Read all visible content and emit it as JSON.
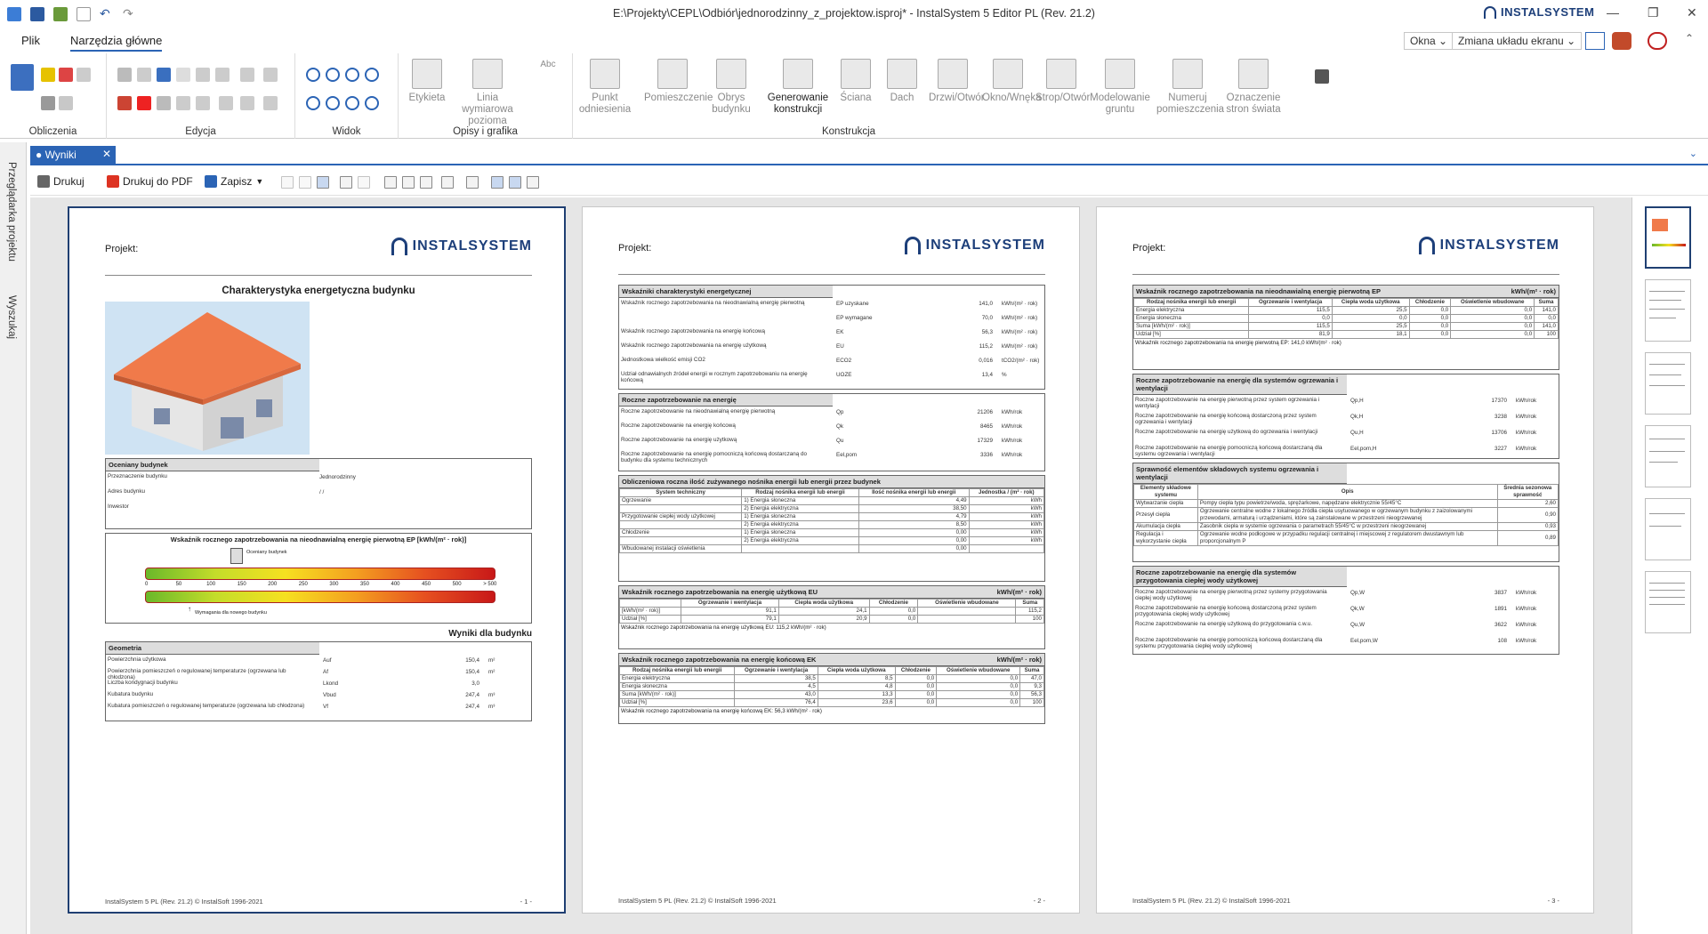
{
  "window": {
    "title": "E:\\Projekty\\CEPL\\Odbiór\\jednorodzinny_z_projektow.isproj* - InstalSystem 5 Editor PL (Rev. 21.2)",
    "brand": "INSTALSYSTEM",
    "minimize": "—",
    "restore": "❐",
    "close": "✕"
  },
  "menu": {
    "tabs": [
      "Plik",
      "Narzędzia główne"
    ],
    "window_btn": "Okna ⌄",
    "layout_btn": "Zmiana układu ekranu ⌄"
  },
  "ribbon": {
    "groups": [
      "Obliczenia",
      "Edycja",
      "Widok",
      "Opisy i grafika",
      "Konstrukcja"
    ],
    "opisy_buttons": [
      "Etykieta",
      "Linia wymiarowa pozioma",
      "Abc"
    ],
    "konstrukcja_buttons": [
      "Punkt odniesienia",
      "Pomieszczenie",
      "Obrys budynku",
      "Generowanie konstrukcji",
      "Ściana",
      "Dach",
      "Drzwi/Otwór",
      "Okno/Wnęka",
      "Strop/Otwór",
      "Modelowanie gruntu",
      "Numeruj pomieszczenia",
      "Oznaczenie stron świata"
    ]
  },
  "doc_tab": {
    "label": "● Wyniki",
    "close": "✕"
  },
  "side": {
    "browser": "Przeglądarka projektu",
    "search": "Wyszukaj"
  },
  "toolbar": {
    "print": "Drukuj",
    "pdf": "Drukuj do PDF",
    "save": "Zapisz"
  },
  "common": {
    "projekt": "Projekt:",
    "logo": "INSTALSYSTEM",
    "footer": "InstalSystem 5 PL (Rev. 21.2) © InstalSoft 1996-2021"
  },
  "page1": {
    "title": "Charakterystyka energetyczna budynku",
    "building_header": "Oceniany budynek",
    "building_rows": [
      {
        "label": "Przeznaczenie budynku",
        "value": "Jednorodzinny"
      },
      {
        "label": "Adres budynku",
        "value": "/ /"
      },
      {
        "label": "Inwestor",
        "value": ""
      }
    ],
    "ep_title": "Wskaźnik rocznego zapotrzebowania na nieodnawialną energię pierwotną EP [kWh/(m² · rok)]",
    "ep_marker_top": "Oceniany budynek",
    "ep_marker_bottom": "Wymagania dla nowego budynku",
    "scale": [
      "0",
      "50",
      "100",
      "150",
      "200",
      "250",
      "300",
      "350",
      "400",
      "450",
      "500",
      "> 500"
    ],
    "results_title": "Wyniki dla budynku",
    "geom_header": "Geometria",
    "geom_rows": [
      {
        "label": "Powierzchnia użytkowa",
        "sym": "Auf",
        "value": "150,4",
        "unit": "m²"
      },
      {
        "label": "Powierzchnia pomieszczeń o regulowanej temperaturze (ogrzewana lub chłodzona)",
        "sym": "Af",
        "value": "150,4",
        "unit": "m²"
      },
      {
        "label": "Liczba kondygnacji budynku",
        "sym": "Lkond",
        "value": "3,0",
        "unit": ""
      },
      {
        "label": "Kubatura budynku",
        "sym": "Vbud",
        "value": "247,4",
        "unit": "m³"
      },
      {
        "label": "Kubatura pomieszczeń o regulowanej temperaturze (ogrzewana lub chłodzona)",
        "sym": "Vf",
        "value": "247,4",
        "unit": "m³"
      }
    ],
    "page_no": "- 1 -"
  },
  "page2": {
    "sec1": "Wskaźniki charakterystyki energetycznej",
    "sec1_rows": [
      {
        "label": "Wskaźnik rocznego zapotrzebowania na nieodnawialną energię pierwotną",
        "sym": "EP uzyskane",
        "value": "141,0",
        "unit": "kWh/(m² · rok)"
      },
      {
        "label": "",
        "sym": "EP wymagane",
        "value": "70,0",
        "unit": "kWh/(m² · rok)"
      },
      {
        "label": "Wskaźnik rocznego zapotrzebowania na energię końcową",
        "sym": "EK",
        "value": "56,3",
        "unit": "kWh/(m² · rok)"
      },
      {
        "label": "Wskaźnik rocznego zapotrzebowania na energię użytkową",
        "sym": "EU",
        "value": "115,2",
        "unit": "kWh/(m² · rok)"
      },
      {
        "label": "Jednostkowa wielkość emisji CO2",
        "sym": "ECO2",
        "value": "0,016",
        "unit": "tCO2/(m² · rok)"
      },
      {
        "label": "Udział odnawialnych źródeł energii w rocznym zapotrzebowaniu na energię końcową",
        "sym": "UOZE",
        "value": "13,4",
        "unit": "%"
      }
    ],
    "sec2": "Roczne zapotrzebowanie na energię",
    "sec2_rows": [
      {
        "label": "Roczne zapotrzebowanie na nieodnawialną energię pierwotną",
        "sym": "Qp",
        "value": "21206",
        "unit": "kWh/rok"
      },
      {
        "label": "Roczne zapotrzebowanie na energię końcową",
        "sym": "Qk",
        "value": "8465",
        "unit": "kWh/rok"
      },
      {
        "label": "Roczne zapotrzebowanie na energię użytkową",
        "sym": "Qu",
        "value": "17329",
        "unit": "kWh/rok"
      },
      {
        "label": "Roczne zapotrzebowanie na energię pomocniczą końcową dostarczaną do budynku dla systemu technicznych",
        "sym": "Eel,pom",
        "value": "3336",
        "unit": "kWh/rok"
      }
    ],
    "sec3": "Obliczeniowa roczna ilość zużywanego nośnika energii lub energii przez budynek",
    "sec3_cols": [
      "System techniczny",
      "Rodzaj nośnika energii lub energii",
      "Ilość nośnika energii lub energii",
      "Jednostka / (m² · rok)"
    ],
    "sec3_rows": [
      [
        "Ogrzewanie",
        "1) Energia słoneczna",
        "4,49",
        "kWh"
      ],
      [
        "",
        "2) Energia elektryczna",
        "38,50",
        "kWh"
      ],
      [
        "Przygotowanie ciepłej wody użytkowej",
        "1) Energia słoneczna",
        "4,79",
        "kWh"
      ],
      [
        "",
        "2) Energia elektryczna",
        "8,50",
        "kWh"
      ],
      [
        "Chłodzenie",
        "1) Energia słoneczna",
        "0,00",
        "kWh"
      ],
      [
        "",
        "2) Energia elektryczna",
        "0,00",
        "kWh"
      ],
      [
        "Wbudowanej instalacji oświetlenia",
        "",
        "0,00",
        ""
      ]
    ],
    "sec4": "Wskaźnik rocznego zapotrzebowania na energię użytkową EU",
    "unit_right": "kWh/(m² · rok)",
    "sec4_cols": [
      "",
      "Ogrzewanie i wentylacja",
      "Ciepła woda użytkowa",
      "Chłodzenie",
      "Oświetlenie wbudowane",
      "Suma"
    ],
    "sec4_rows": [
      [
        "[kWh/(m² · rok)]",
        "91,1",
        "24,1",
        "0,0",
        "",
        "115,2"
      ],
      [
        "Udział [%]",
        "79,1",
        "20,9",
        "0,0",
        "",
        "100"
      ]
    ],
    "sec4_note": "Wskaźnik rocznego zapotrzebowania na energię użytkową EU: 115,2 kWh/(m² · rok)",
    "sec5": "Wskaźnik rocznego zapotrzebowania na energię końcową EK",
    "sec5_cols": [
      "Rodzaj nośnika energii lub energii",
      "Ogrzewanie i wentylacja",
      "Ciepła woda użytkowa",
      "Chłodzenie",
      "Oświetlenie wbudowane",
      "Suma"
    ],
    "sec5_rows": [
      [
        "Energia elektryczna",
        "38,5",
        "8,5",
        "0,0",
        "0,0",
        "47,0"
      ],
      [
        "Energia słoneczna",
        "4,5",
        "4,8",
        "0,0",
        "0,0",
        "9,3"
      ],
      [
        "Suma [kWh/(m² · rok)]",
        "43,0",
        "13,3",
        "0,0",
        "0,0",
        "56,3"
      ],
      [
        "Udział [%]",
        "76,4",
        "23,6",
        "0,0",
        "0,0",
        "100"
      ]
    ],
    "sec5_note": "Wskaźnik rocznego zapotrzebowania na energię końcową EK: 56,3 kWh/(m² · rok)",
    "page_no": "- 2 -"
  },
  "page3": {
    "sec1": "Wskaźnik rocznego zapotrzebowania na nieodnawialną energię pierwotną EP",
    "unit_right": "kWh/(m² · rok)",
    "sec1_cols": [
      "Rodzaj nośnika energii lub energii",
      "Ogrzewanie i wentylacja",
      "Ciepła woda użytkowa",
      "Chłodzenie",
      "Oświetlenie wbudowane",
      "Suma"
    ],
    "sec1_rows": [
      [
        "Energia elektryczna",
        "115,5",
        "25,5",
        "0,0",
        "0,0",
        "141,0"
      ],
      [
        "Energia słoneczna",
        "0,0",
        "0,0",
        "0,0",
        "0,0",
        "0,0"
      ],
      [
        "Suma [kWh/(m² · rok)]",
        "115,5",
        "25,5",
        "0,0",
        "0,0",
        "141,0"
      ],
      [
        "Udział [%]",
        "81,9",
        "18,1",
        "0,0",
        "0,0",
        "100"
      ]
    ],
    "sec1_note": "Wskaźnik rocznego zapotrzebowania na energię pierwotną EP: 141,0 kWh/(m² · rok)",
    "sec2": "Roczne zapotrzebowanie na energię dla systemów ogrzewania i wentylacji",
    "sec2_rows": [
      {
        "label": "Roczne zapotrzebowanie na energię pierwotną przez system ogrzewania i wentylacji",
        "sym": "Qp,H",
        "value": "17370",
        "unit": "kWh/rok"
      },
      {
        "label": "Roczne zapotrzebowanie na energię końcową dostarczoną przez system ogrzewania i wentylacji",
        "sym": "Qk,H",
        "value": "3238",
        "unit": "kWh/rok"
      },
      {
        "label": "Roczne zapotrzebowanie na energię użytkową do ogrzewania i wentylacji",
        "sym": "Qu,H",
        "value": "13706",
        "unit": "kWh/rok"
      },
      {
        "label": "Roczne zapotrzebowanie na energię pomocniczą końcową dostarczaną dla systemu ogrzewania i wentylacji",
        "sym": "Eel,pom,H",
        "value": "3227",
        "unit": "kWh/rok"
      }
    ],
    "sec3": "Sprawność elementów składowych systemu ogrzewania i wentylacji",
    "sec3_cols": [
      "Elementy składowe systemu",
      "Opis",
      "Średnia sezonowa sprawność"
    ],
    "sec3_rows": [
      [
        "Wytwarzanie ciepła",
        "Pompy ciepła typu powietrze/woda, sprężarkowe, napędzane elektrycznie 55/45°C",
        "2,60"
      ],
      [
        "Przesył ciepła",
        "Ogrzewanie centralne wodne z lokalnego źródła ciepła usytuowanego w ogrzewanym budynku z zaizolowanymi przewodami, armaturą i urządzeniami, które są zainstalowane w przestrzeni nieogrzewanej",
        "0,90"
      ],
      [
        "Akumulacja ciepła",
        "Zasobnik ciepła w systemie ogrzewania o parametrach 55/45°C w przestrzeni nieogrzewanej",
        "0,93"
      ],
      [
        "Regulacja i wykorzystanie ciepła",
        "Ogrzewanie wodne podłogowe w przypadku regulacji centralnej i miejscowej z regulatorem dwustawnym lub proporcjonalnym P",
        "0,89"
      ]
    ],
    "sec4": "Roczne zapotrzebowanie na energię dla systemów przygotowania ciepłej wody użytkowej",
    "sec4_rows": [
      {
        "label": "Roczne zapotrzebowanie na energię pierwotną przez systemy przygotowania ciepłej wody użytkowej",
        "sym": "Qp,W",
        "value": "3837",
        "unit": "kWh/rok"
      },
      {
        "label": "Roczne zapotrzebowanie na energię końcową dostarczoną przez system przygotowania ciepłej wody użytkowej",
        "sym": "Qk,W",
        "value": "1891",
        "unit": "kWh/rok"
      },
      {
        "label": "Roczne zapotrzebowanie na energię użytkową do przygotowania c.w.u.",
        "sym": "Qu,W",
        "value": "3622",
        "unit": "kWh/rok"
      },
      {
        "label": "Roczne zapotrzebowanie na energię pomocniczą końcową dostarczaną dla systemu przygotowania ciepłej wody użytkowej",
        "sym": "Eel,pom,W",
        "value": "108",
        "unit": "kWh/rok"
      }
    ],
    "page_no": "- 3 -"
  },
  "colors": {
    "accent": "#2b64b5",
    "brand": "#1d3f7a",
    "roof": "#f07a4a"
  }
}
